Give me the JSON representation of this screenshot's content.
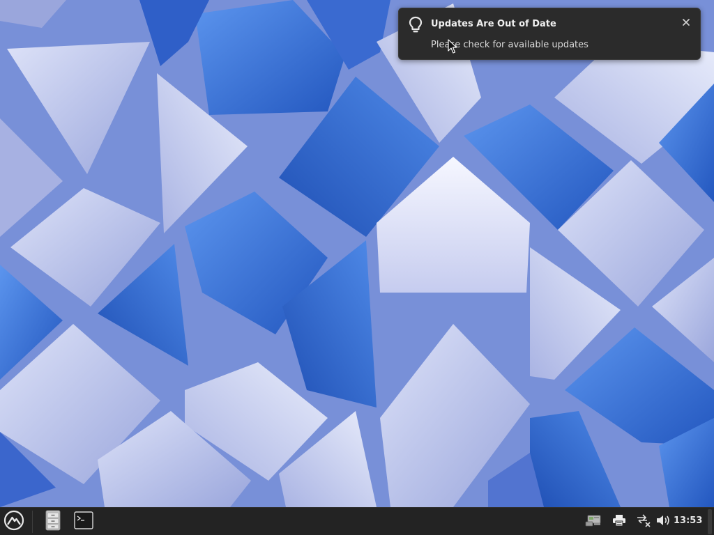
{
  "notification": {
    "title": "Updates Are Out of Date",
    "body": "Please check for available updates",
    "icon": "lightbulb-icon",
    "close_icon": "close-icon"
  },
  "taskbar": {
    "launcher_icon": "mountain-logo-icon",
    "tasks": [
      {
        "name": "file-manager",
        "icon": "file-cabinet-icon"
      },
      {
        "name": "terminal",
        "icon": "terminal-icon"
      }
    ],
    "tray": [
      {
        "name": "network-manager",
        "icon": "network-card-icon"
      },
      {
        "name": "printer",
        "icon": "printer-icon"
      },
      {
        "name": "network-disconnected",
        "icon": "network-offline-icon"
      },
      {
        "name": "volume",
        "icon": "volume-icon"
      }
    ],
    "clock": "13:53"
  },
  "colors": {
    "panel_bg": "#232323",
    "notification_bg": "#2b2b2b",
    "wallpaper_blue": "#2f66d2",
    "wallpaper_lavender": "#b8c2ea"
  }
}
